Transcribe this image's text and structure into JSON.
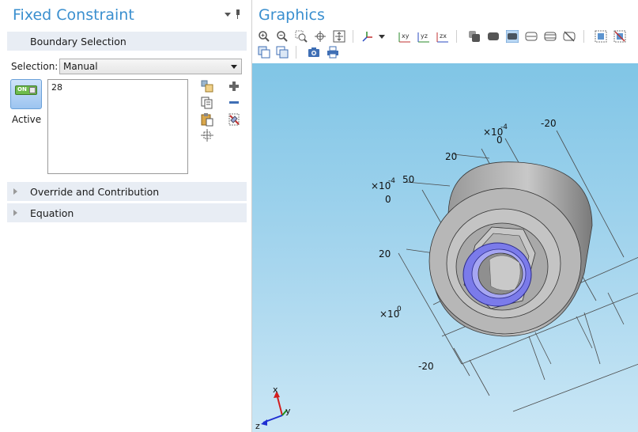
{
  "settings": {
    "title": "Fixed Constraint",
    "sections": {
      "boundary_selection": "Boundary Selection",
      "override": "Override and Contribution",
      "equation": "Equation"
    },
    "selection_label": "Selection:",
    "selection_value": "Manual",
    "selected_items": [
      "28"
    ],
    "active_toggle_text": "ON",
    "active_label": "Active"
  },
  "graphics": {
    "title": "Graphics",
    "toolbar_icons": [
      "zoom-in-icon",
      "zoom-out-icon",
      "zoom-box-icon",
      "zoom-selected-icon",
      "zoom-extents-icon",
      "axes-orientation-icon",
      "view-xy-icon",
      "view-yz-icon",
      "view-zx-icon",
      "transparency-icon",
      "wireframe-icon",
      "surface-render-icon",
      "scene-light-icon",
      "grid-icon",
      "hide-icon",
      "select-all-icon",
      "clear-selection-icon",
      "reset-hiding-icon",
      "view-settings-icon",
      "image-snapshot-icon",
      "print-icon"
    ],
    "axis_labels": {
      "x_scale_1": "×10",
      "x_scale_exp_1": "-4",
      "x_scale_2": "×10",
      "x_scale_exp_2": "-4",
      "x_scale_3": "×10",
      "x_scale_exp_3": "0",
      "tick_neg20_top": "-20",
      "tick_0_top": "0",
      "tick_20_top": "20",
      "tick_50": "50",
      "tick_0_left": "0",
      "tick_20_left": "20",
      "tick_neg20_bottom": "-20"
    },
    "triad": {
      "x": "x",
      "y": "y",
      "z": "z"
    },
    "colors": {
      "accent_title": "#3a8fcf",
      "selection_highlight": "#6f6fe8",
      "geometry_gray": "#b8b8b8"
    }
  }
}
